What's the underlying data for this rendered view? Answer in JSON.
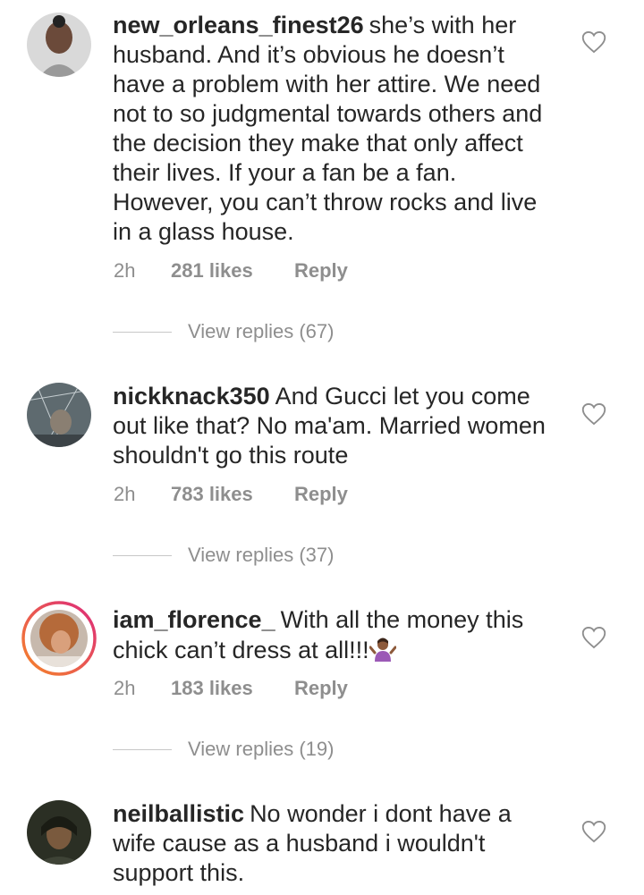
{
  "comments": [
    {
      "username": "new_orleans_finest26",
      "text": "she’s with her husband. And it’s obvious he doesn’t have a problem with her attire. We need not to so judgmental towards others and the decision they make that only affect their lives. If your a fan be a fan. However, you can’t throw rocks and live in a glass house.",
      "time": "2h",
      "likes": "281 likes",
      "reply_label": "Reply",
      "view_replies": "View replies (67)"
    },
    {
      "username": "nickknack350",
      "text": "And Gucci let you come out like that? No ma'am. Married women shouldn't go this route",
      "time": "2h",
      "likes": "783 likes",
      "reply_label": "Reply",
      "view_replies": "View replies (37)"
    },
    {
      "username": "iam_florence_",
      "text": "With all the money this chick can’t dress at all!!!",
      "emoji": "person-shrugging-emoji",
      "time": "2h",
      "likes": "183 likes",
      "reply_label": "Reply",
      "view_replies": "View replies (19)"
    },
    {
      "username": "neilballistic",
      "text": "No wonder i dont have a wife cause as a husband i wouldn't support this.",
      "time": "",
      "likes": "",
      "reply_label": "",
      "view_replies": ""
    }
  ],
  "colors": {
    "text": "#262626",
    "meta": "#8e8e8e",
    "story_ring_start": "#f58529",
    "story_ring_end": "#dd2a7b"
  },
  "icons": {
    "like": "heart-outline-icon"
  }
}
